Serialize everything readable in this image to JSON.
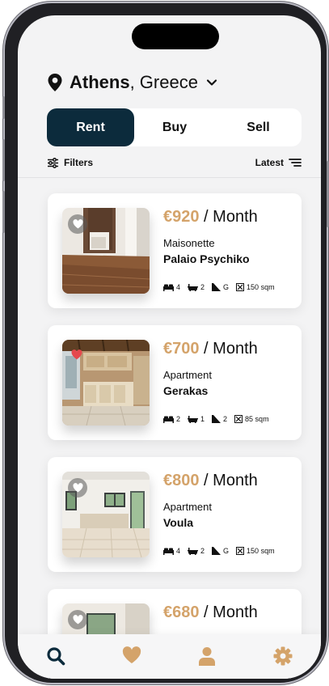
{
  "location": {
    "city": "Athens",
    "country": ", Greece"
  },
  "segment": {
    "rent": "Rent",
    "buy": "Buy",
    "sell": "Sell",
    "selected": "Rent"
  },
  "toolbar": {
    "filters": "Filters",
    "sort": "Latest"
  },
  "colors": {
    "accent": "#d4a36a",
    "primary": "#0c2b3c",
    "favorite": "#e5484d"
  },
  "listings": [
    {
      "amount": "€920",
      "period": " / Month",
      "type": "Maisonette",
      "area": "Palaio Psychiko",
      "beds": "4",
      "baths": "2",
      "floor": "G",
      "size": "150 sqm",
      "favorite": false
    },
    {
      "amount": "€700",
      "period": " / Month",
      "type": "Apartment",
      "area": "Gerakas",
      "beds": "2",
      "baths": "1",
      "floor": "2",
      "size": "85 sqm",
      "favorite": true
    },
    {
      "amount": "€800",
      "period": " / Month",
      "type": "Apartment",
      "area": "Voula",
      "beds": "4",
      "baths": "2",
      "floor": "G",
      "size": "150 sqm",
      "favorite": false
    },
    {
      "amount": "€680",
      "period": " / Month",
      "favorite": false
    }
  ],
  "tabs": [
    {
      "icon": "search-icon",
      "active": true
    },
    {
      "icon": "heart-icon",
      "active": false
    },
    {
      "icon": "user-icon",
      "active": false
    },
    {
      "icon": "gear-icon",
      "active": false
    }
  ]
}
